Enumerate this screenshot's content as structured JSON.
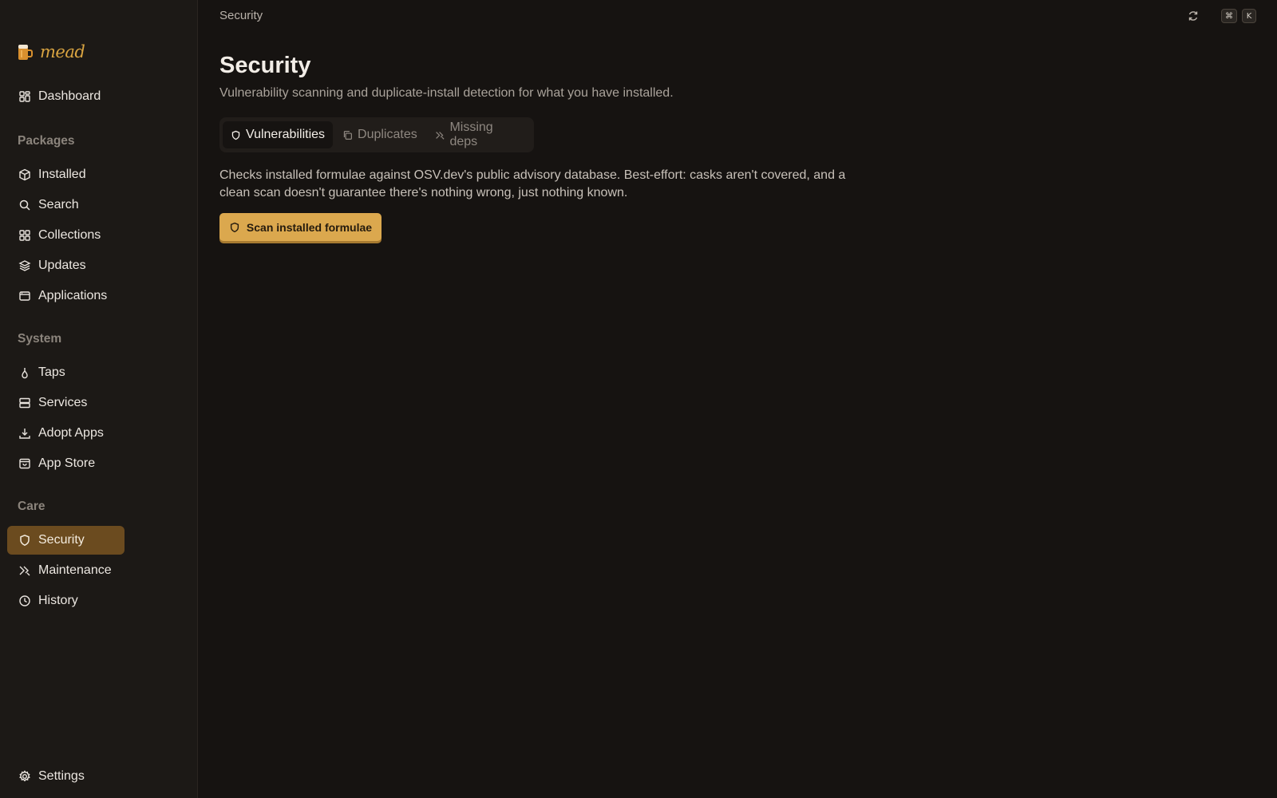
{
  "app": {
    "name": "mead"
  },
  "topbar": {
    "title": "Security",
    "shortcut_keys": [
      "⌘",
      "K"
    ]
  },
  "sidebar": {
    "dashboard": "Dashboard",
    "sections": {
      "packages": "Packages",
      "system": "System",
      "care": "Care"
    },
    "items": {
      "installed": "Installed",
      "search": "Search",
      "collections": "Collections",
      "updates": "Updates",
      "applications": "Applications",
      "taps": "Taps",
      "services": "Services",
      "adopt_apps": "Adopt Apps",
      "app_store": "App Store",
      "security": "Security",
      "maintenance": "Maintenance",
      "history": "History"
    },
    "settings": "Settings",
    "active_item": "security"
  },
  "main": {
    "title": "Security",
    "subtitle": "Vulnerability scanning and duplicate-install detection for what you have installed.",
    "tabs": [
      {
        "label": "Vulnerabilities",
        "icon": "shield-icon",
        "active": true
      },
      {
        "label": "Duplicates",
        "icon": "copy-icon",
        "active": false
      },
      {
        "label": "Missing deps",
        "icon": "wrench-icon",
        "active": false
      }
    ],
    "description": "Checks installed formulae against OSV.dev's public advisory database. Best-effort: casks aren't covered, and a clean scan doesn't guarantee there's nothing wrong, just nothing known.",
    "scan_button": "Scan installed formulae"
  },
  "colors": {
    "accent": "#dba84e",
    "active_nav": "#6b4b1f",
    "background": "#161311",
    "sidebar": "#1c1916"
  }
}
